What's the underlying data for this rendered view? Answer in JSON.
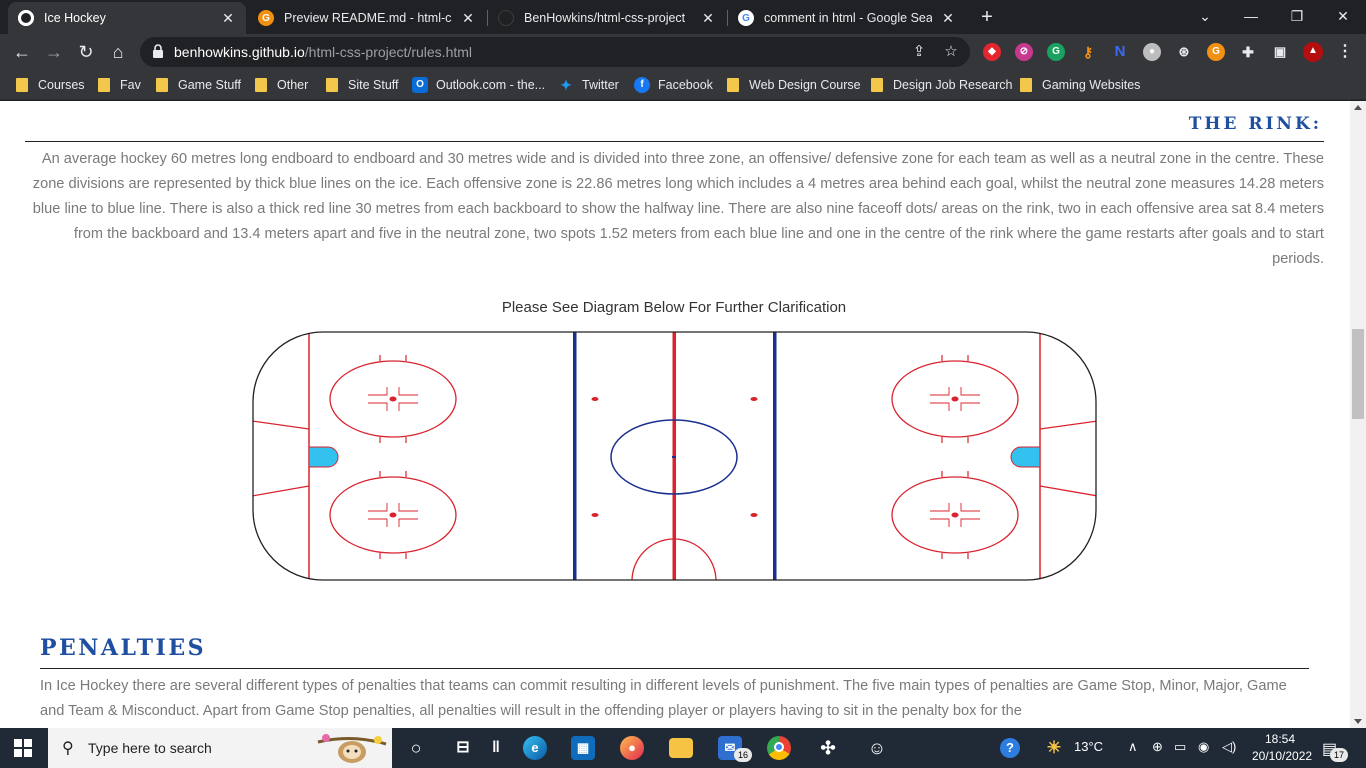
{
  "browser": {
    "tabs": [
      {
        "title": "Ice Hockey",
        "active": true
      },
      {
        "title": "Preview README.md - html-css-p",
        "active": false
      },
      {
        "title": "BenHowkins/html-css-project",
        "active": false
      },
      {
        "title": "comment in html - Google Searc",
        "active": false
      }
    ],
    "new_tab_symbol": "+",
    "address": {
      "domain": "benhowkins.github.io",
      "path": "/html-css-project/rules.html"
    }
  },
  "bookmarks": [
    {
      "label": "Courses",
      "icon": "folder-icon"
    },
    {
      "label": "Fav",
      "icon": "folder-icon"
    },
    {
      "label": "Game Stuff",
      "icon": "folder-icon"
    },
    {
      "label": "Other",
      "icon": "folder-icon"
    },
    {
      "label": "Site Stuff",
      "icon": "folder-icon"
    },
    {
      "label": "Outlook.com - the...",
      "icon": "outlook-icon"
    },
    {
      "label": "Twitter",
      "icon": "twitter-icon"
    },
    {
      "label": "Facebook",
      "icon": "facebook-icon"
    },
    {
      "label": "Web Design Course",
      "icon": "folder-icon"
    },
    {
      "label": "Design Job Research",
      "icon": "folder-icon"
    },
    {
      "label": "Gaming Websites",
      "icon": "folder-icon"
    }
  ],
  "page": {
    "rink_heading": "THE RINK:",
    "rink_text": "An average hockey 60 metres long endboard to endboard and 30 metres wide and is divided into three zone, an offensive/ defensive zone for each team as well as a neutral zone in the centre. These zone divisions are represented by thick blue lines on the ice. Each offensive zone is 22.86 metres long which includes a 4 metres area behind each goal, whilst the neutral zone measures 14.28 meters blue line to blue line. There is also a thick red line 30 metres from each backboard to show the halfway line. There are also nine faceoff dots/ areas on the rink, two in each offensive area sat 8.4 meters from the backboard and 13.4 meters apart and five in the neutral zone, two spots 1.52 meters from each blue line and one in the centre of the rink where the game restarts after goals and to start periods.",
    "diagram_caption": "Please See Diagram Below For Further Clarification",
    "penalties_heading": "PENALTIES",
    "penalties_text": "In Ice Hockey there are several different types of penalties that teams can commit resulting in different levels of punishment. The five main types of penalties are Game Stop, Minor, Major, Game and Team & Misconduct. Apart from Game Stop penalties, all penalties will result in the offending player or players having to sit in the penalty box for the"
  },
  "colors": {
    "heading_blue": "#1e4fa0",
    "rink_red": "#d9232e",
    "rink_blue": "#1a2f8f",
    "crease_blue": "#33c2f0"
  },
  "taskbar": {
    "search_placeholder": "Type here to search",
    "mail_badge": "16",
    "weather": "13°C",
    "time": "18:54",
    "date": "20/10/2022",
    "notification_count": "17"
  }
}
